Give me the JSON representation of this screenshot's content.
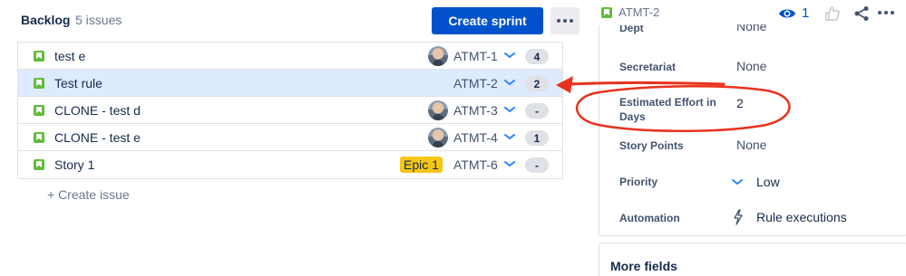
{
  "backlog": {
    "title": "Backlog",
    "count": "5 issues",
    "create_sprint_label": "Create sprint",
    "more_icon": "more-horizontal-icon",
    "create_issue_label": "+ Create issue",
    "issues": [
      {
        "summary": "test e",
        "key": "ATMT-1",
        "points": "4",
        "avatar": true,
        "epic": "",
        "selected": false
      },
      {
        "summary": "Test rule",
        "key": "ATMT-2",
        "points": "2",
        "avatar": false,
        "epic": "",
        "selected": true
      },
      {
        "summary": "CLONE - test d",
        "key": "ATMT-3",
        "points": "-",
        "avatar": true,
        "epic": "",
        "selected": false
      },
      {
        "summary": "CLONE - test e",
        "key": "ATMT-4",
        "points": "1",
        "avatar": true,
        "epic": "",
        "selected": false
      },
      {
        "summary": "Story 1",
        "key": "ATMT-6",
        "points": "-",
        "avatar": false,
        "epic": "Epic 1",
        "selected": false
      }
    ]
  },
  "panel": {
    "issue_key": "ATMT-2",
    "watch_count": "1",
    "fields": {
      "dept_label": "Dept",
      "dept_value": "None",
      "secretariat_label": "Secretariat",
      "secretariat_value": "None",
      "effort_label": "Estimated Effort in Days",
      "effort_value": "2",
      "story_points_label": "Story Points",
      "story_points_value": "None",
      "priority_label": "Priority",
      "priority_value": "Low",
      "automation_label": "Automation",
      "automation_value": "Rule executions"
    },
    "more_fields_label": "More fields"
  },
  "colors": {
    "primary": "#0052cc",
    "selected_row": "#deebff",
    "story_icon": "#63ba3c",
    "epic_badge": "#f5c518",
    "annotation": "#e8321d"
  }
}
